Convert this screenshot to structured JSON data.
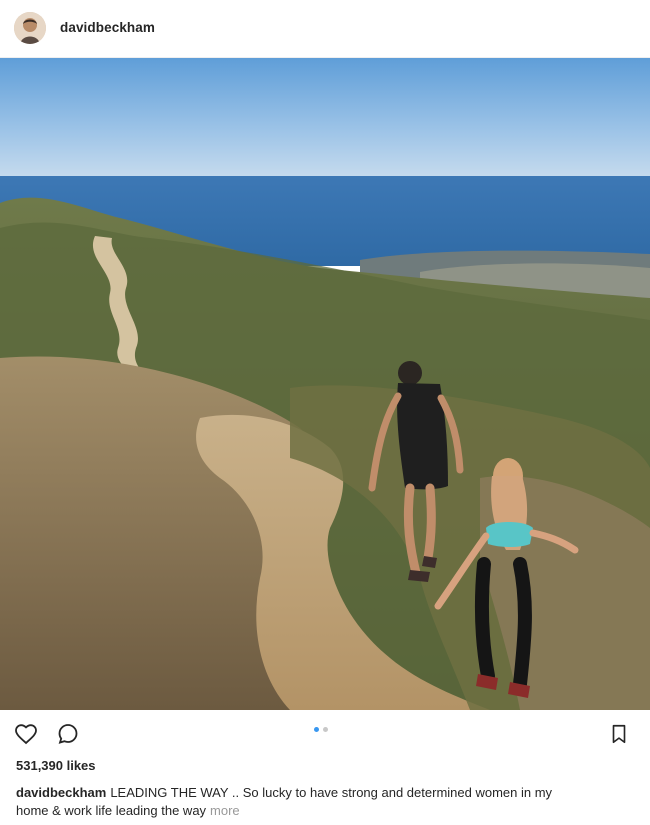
{
  "post": {
    "username": "davidbeckham",
    "likes": "531,390 likes",
    "caption_user": "davidbeckham",
    "caption_line1": "LEADING THE WAY .. So lucky to have strong and determined women in my",
    "caption_line2": "home & work life leading the way",
    "more_label": "more",
    "carousel": {
      "count": 2,
      "active_index": 0
    }
  },
  "icons": {
    "like": "heart-icon",
    "comment": "comment-icon",
    "save": "bookmark-icon"
  },
  "colors": {
    "text": "#262626",
    "muted": "#999999",
    "accent": "#3897f0",
    "divider": "#efefef"
  }
}
